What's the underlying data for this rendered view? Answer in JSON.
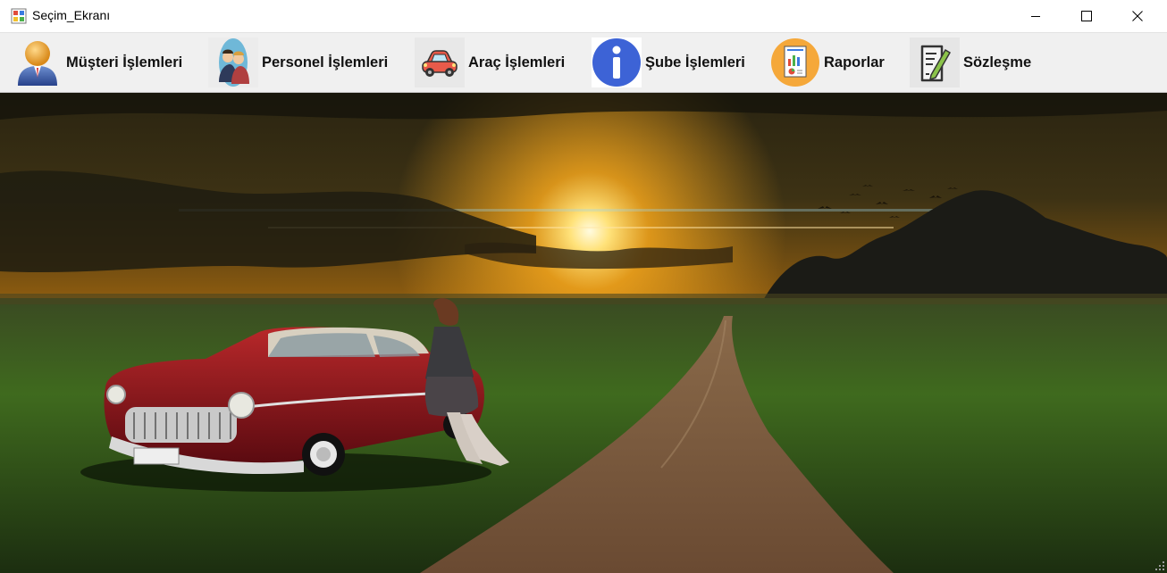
{
  "window": {
    "title": "Seçim_Ekranı",
    "controls": [
      "minimize-icon",
      "maximize-icon",
      "close-icon"
    ]
  },
  "menu": {
    "items": [
      {
        "label": "Müşteri İşlemleri",
        "icon": "customer-person-icon"
      },
      {
        "label": "Personel İşlemleri",
        "icon": "staff-people-icon"
      },
      {
        "label": "Araç İşlemleri",
        "icon": "car-icon"
      },
      {
        "label": "Şube İşlemleri",
        "icon": "info-icon"
      },
      {
        "label": "Raporlar",
        "icon": "report-chart-icon"
      },
      {
        "label": "Sözleşme",
        "icon": "contract-document-icon"
      }
    ]
  },
  "colors": {
    "titlebar": "#ffffff",
    "menustrip": "#f0f0f0",
    "info_blue": "#3d63d6",
    "report_orange": "#f5a83a",
    "sky_glow": "#f3a51c"
  }
}
